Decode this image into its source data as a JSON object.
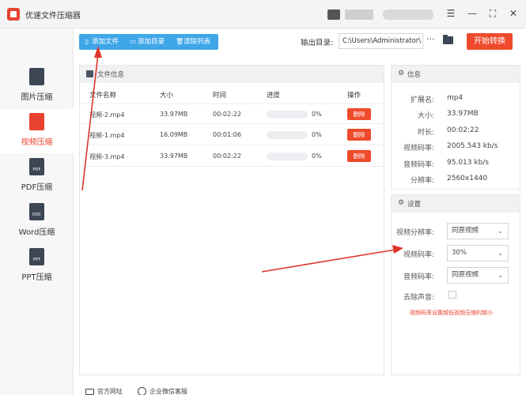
{
  "window": {
    "title": "优速文件压缩器",
    "controls": [
      "menu-icon",
      "minimize-icon",
      "maximize-icon",
      "close-icon"
    ]
  },
  "sidebar": {
    "items": [
      {
        "label": "图片压缩",
        "icon": "image-file-icon",
        "active": false
      },
      {
        "label": "视频压缩",
        "icon": "video-file-icon",
        "active": true
      },
      {
        "label": "PDF压缩",
        "icon": "pdf-file-icon",
        "icon_text": "PDF",
        "active": false
      },
      {
        "label": "Word压缩",
        "icon": "doc-file-icon",
        "icon_text": "DOC",
        "active": false
      },
      {
        "label": "PPT压缩",
        "icon": "ppt-file-icon",
        "icon_text": "PPT",
        "active": false
      }
    ]
  },
  "toolbar": {
    "add_file": "添加文件",
    "add_folder": "添加目录",
    "clear_list": "清除列表",
    "output_label": "输出目录:",
    "output_path": "C:\\Users\\Administrator\\",
    "more": "···",
    "start": "开始转换"
  },
  "file_panel": {
    "title": "文件信息",
    "columns": [
      "文件名称",
      "大小",
      "时间",
      "进度",
      "操作"
    ],
    "rows": [
      {
        "name": "视频-2.mp4",
        "size": "33.97MB",
        "time": "00:02:22",
        "progress": "0%",
        "action": "删除"
      },
      {
        "name": "视频-1.mp4",
        "size": "16.09MB",
        "time": "00:01:06",
        "progress": "0%",
        "action": "删除"
      },
      {
        "name": "视频-3.mp4",
        "size": "33.97MB",
        "time": "00:02:22",
        "progress": "0%",
        "action": "删除"
      }
    ]
  },
  "info": {
    "title": "信息",
    "rows": [
      {
        "key": "扩展名:",
        "value": "mp4"
      },
      {
        "key": "大小:",
        "value": "33.97MB"
      },
      {
        "key": "时长:",
        "value": "00:02:22"
      },
      {
        "key": "视频码率:",
        "value": "2005.543 kb/s"
      },
      {
        "key": "音频码率:",
        "value": "95.013 kb/s"
      },
      {
        "key": "分辨率:",
        "value": "2560x1440"
      }
    ]
  },
  "settings": {
    "title": "设置",
    "resolution": {
      "label": "视频分辨率:",
      "value": "同原视频"
    },
    "video_bitrate": {
      "label": "视频码率:",
      "value": "30%"
    },
    "audio_bitrate": {
      "label": "音频码率:",
      "value": "同原视频"
    },
    "remove_audio": {
      "label": "去除声音:",
      "checked": false
    },
    "hint": "视频码率设置越低视频压缩的越小"
  },
  "footer": {
    "website": "官方网址",
    "support": "企业微信客服"
  },
  "colors": {
    "accent_red": "#ef4a2c",
    "toolbar_blue": "#3fa7e8",
    "annotation_arrow": "#e0342b"
  }
}
